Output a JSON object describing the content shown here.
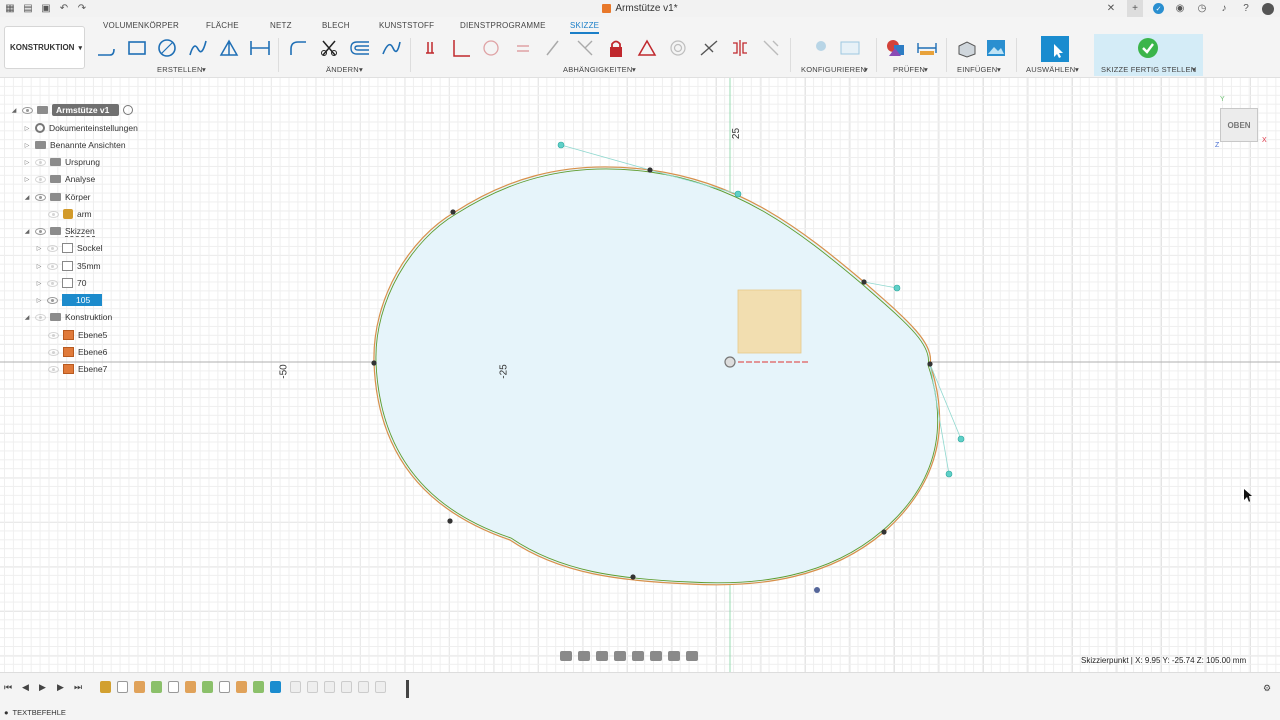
{
  "window": {
    "title": "Armstütze v1*"
  },
  "tabs": [
    {
      "label": "VOLUMENKÖRPER"
    },
    {
      "label": "FLÄCHE"
    },
    {
      "label": "NETZ"
    },
    {
      "label": "BLECH"
    },
    {
      "label": "KUNSTSTOFF"
    },
    {
      "label": "DIENSTPROGRAMME"
    },
    {
      "label": "SKIZZE",
      "active": true
    }
  ],
  "toolbar": {
    "workspace": "KONSTRUKTION",
    "groups": {
      "create": "ERSTELLEN",
      "modify": "ÄNDERN",
      "constraints": "ABHÄNGIGKEITEN",
      "configure": "KONFIGURIEREN",
      "inspect": "PRÜFEN",
      "insert": "EINFÜGEN",
      "select": "AUSWÄHLEN",
      "finish": "SKIZZE FERTIG STELLEN"
    }
  },
  "browser": {
    "root": "Armstütze v1",
    "items": [
      {
        "label": "Dokumenteinstellungen"
      },
      {
        "label": "Benannte Ansichten"
      },
      {
        "label": "Ursprung"
      },
      {
        "label": "Analyse"
      },
      {
        "label": "Körper"
      },
      {
        "label": "arm"
      },
      {
        "label": "Skizzen"
      },
      {
        "label": "Sockel"
      },
      {
        "label": "35mm"
      },
      {
        "label": "70"
      },
      {
        "label": "105"
      },
      {
        "label": "Konstruktion"
      },
      {
        "label": "Ebene5"
      },
      {
        "label": "Ebene6"
      },
      {
        "label": "Ebene7"
      }
    ]
  },
  "canvas": {
    "axis_labels": {
      "v25": "25",
      "hm50": "-50",
      "hm25": "-25"
    },
    "viewcube": {
      "face": "OBEN",
      "y": "Y",
      "x": "X",
      "z": "Z"
    }
  },
  "status": {
    "text": "Skizzierpunkt | X: 9.95 Y: -25.74 Z: 105.00 mm"
  },
  "bottom": {
    "textbefehle": "TEXTBEFEHLE"
  },
  "colors": {
    "accent": "#1b7fc8",
    "finish_bg": "#d4ecf7",
    "sketch_fill": "#e6f4fa",
    "sketch_stroke": "#6a9a3a"
  }
}
